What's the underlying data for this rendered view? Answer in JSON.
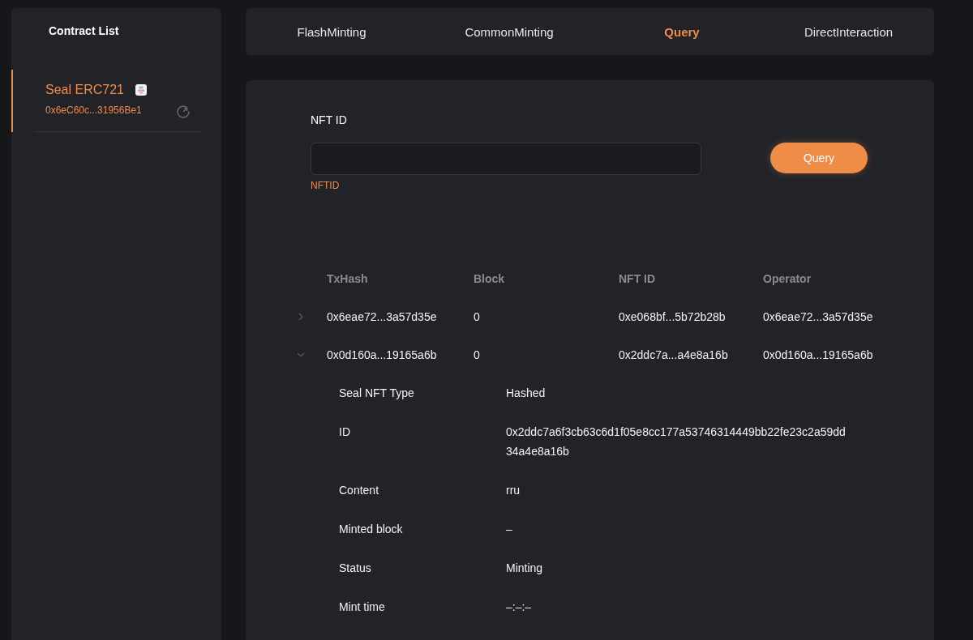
{
  "sidebar": {
    "title": "Contract List",
    "contracts": [
      {
        "name": "Seal ERC721",
        "address": "0x6eC60c...31956Be1",
        "selected": true
      }
    ]
  },
  "tabs": [
    {
      "label": "FlashMinting",
      "selected": false
    },
    {
      "label": "CommonMinting",
      "selected": false
    },
    {
      "label": "Query",
      "selected": true
    },
    {
      "label": "DirectInteraction",
      "selected": false
    }
  ],
  "query_form": {
    "label": "NFT ID",
    "hint": "NFTID",
    "button": "Query"
  },
  "table": {
    "columns": [
      "TxHash",
      "Block",
      "NFT ID",
      "Operator"
    ],
    "rows": [
      {
        "expanded": false,
        "cells": [
          "0x6eae72...3a57d35e",
          "0",
          "0xe068bf...5b72b28b",
          "0x6eae72...3a57d35e"
        ]
      },
      {
        "expanded": true,
        "cells": [
          "0x0d160a...19165a6b",
          "0",
          "0x2ddc7a...a4e8a16b",
          "0x0d160a...19165a6b"
        ],
        "details": [
          {
            "label": "Seal NFT Type",
            "value": "Hashed"
          },
          {
            "label": "ID",
            "value": "0x2ddc7a6f3cb63c6d1f05e8cc177a53746314449bb22fe23c2a59dd34a4e8a16b"
          },
          {
            "label": "Content",
            "value": "rru"
          },
          {
            "label": "Minted block",
            "value": "–"
          },
          {
            "label": "Status",
            "value": "Minting"
          },
          {
            "label": "Mint time",
            "value": "–:–:–"
          }
        ]
      }
    ]
  }
}
